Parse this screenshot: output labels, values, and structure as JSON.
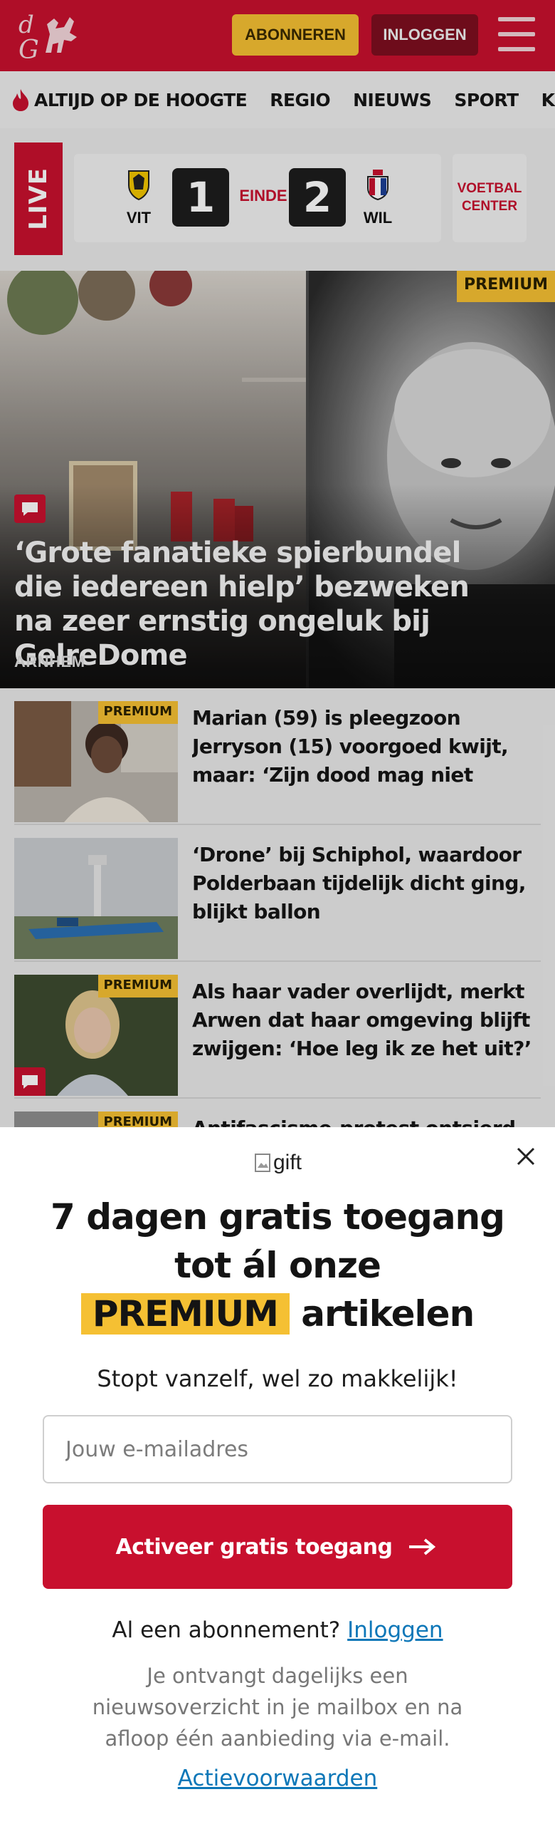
{
  "header": {
    "subscribe_label": "ABONNEREN",
    "login_label": "INLOGGEN"
  },
  "nav": {
    "items": [
      "ALTIJD OP DE HOOGTE",
      "REGIO",
      "NIEUWS",
      "SPORT",
      "KIJK"
    ]
  },
  "live_score": {
    "live_label": "LIVE",
    "home_team": "VIT",
    "away_team": "WIL",
    "home_score": "1",
    "away_score": "2",
    "status": "EINDE",
    "voetbal_center_label": "VOETBAL CENTER"
  },
  "hero": {
    "premium_label": "PREMIUM",
    "title": "‘Grote fanatieke spierbundel die iedereen hielp’ bezweken na zeer ernstig ongeluk bij GelreDome",
    "region": "ARNHEM"
  },
  "articles": [
    {
      "title": "Marian (59) is pleegzoon Jerryson (15) voorgoed kwijt, maar: ‘Zijn dood mag niet voor…",
      "premium": "PREMIUM"
    },
    {
      "title": "‘Drone’ bij Schiphol, waardoor Polderbaan tijdelijk dicht ging, blijkt ballon",
      "premium": ""
    },
    {
      "title": "Als haar vader overlijdt, merkt Arwen dat haar omgeving blijft zwijgen: ‘Hoe leg ik ze het uit?’",
      "premium": "PREMIUM"
    },
    {
      "title": "Antifascisme-protest ontsierd",
      "premium": "PREMIUM"
    }
  ],
  "modal": {
    "gift_alt": "gift",
    "headline_part1": "7 dagen gratis toegang tot ál onze",
    "headline_premium": "PREMIUM",
    "headline_part2": "artikelen",
    "subtitle": "Stopt vanzelf, wel zo makkelijk!",
    "email_placeholder": "Jouw e-mailadres",
    "cta_label": "Activeer gratis toegang",
    "cta_icon_alt": "arrow right",
    "already_subscribed": "Al een abonnement?",
    "login_link": "Inloggen",
    "note": "Je ontvangt dagelijks een nieuwsoverzicht in je mailbox en na afloop één aanbieding via e-mail.",
    "terms_link": "Actievoorwaarden"
  },
  "colors": {
    "brand_red": "#c8102e",
    "premium_yellow": "#f5c033",
    "link_blue": "#0d77b8"
  }
}
